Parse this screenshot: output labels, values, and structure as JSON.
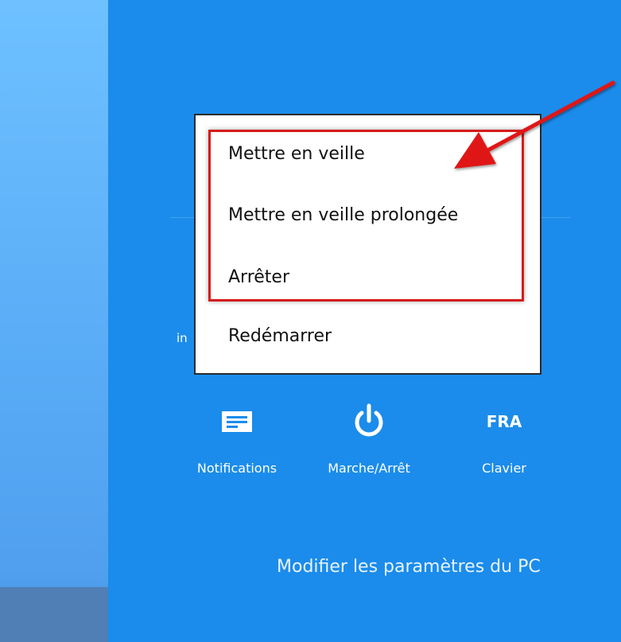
{
  "power_menu": {
    "items": [
      {
        "label": "Mettre en veille"
      },
      {
        "label": "Mettre en veille prolongée"
      },
      {
        "label": "Arrêter"
      },
      {
        "label": "Redémarrer"
      }
    ]
  },
  "partial_text": "in",
  "quick_settings": [
    {
      "icon": "notifications-icon",
      "label": "Notifications"
    },
    {
      "icon": "power-icon",
      "label": "Marche/Arrêt"
    },
    {
      "icon": "keyboard-language-icon",
      "icon_text": "FRA",
      "label": "Clavier"
    }
  ],
  "settings_link": "Modifier les paramètres du PC",
  "colors": {
    "charm_background": "#1b8ceb",
    "highlight": "#d71b1b",
    "menu_background": "#ffffff"
  }
}
